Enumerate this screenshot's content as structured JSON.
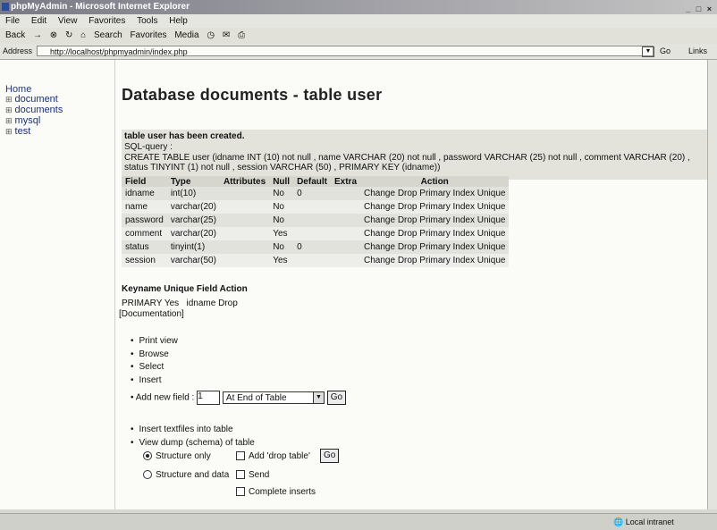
{
  "window": {
    "title": "phpMyAdmin - Microsoft Internet Explorer",
    "controls": "_ □ ×"
  },
  "menu": [
    "File",
    "Edit",
    "View",
    "Favorites",
    "Tools",
    "Help"
  ],
  "toolbar": {
    "back": "Back",
    "search": "Search",
    "favorites": "Favorites",
    "media": "Media"
  },
  "address": {
    "label": "Address",
    "url": "http://localhost/phpmyadmin/index.php",
    "go": "Go",
    "links": "Links"
  },
  "sidebar": {
    "home": "Home",
    "items": [
      "document",
      "documents",
      "mysql",
      "test"
    ],
    "expander": "⊞"
  },
  "main": {
    "title": "Database documents - table user",
    "created_msg": "table user has been created.",
    "sql_label": "SQL-query :",
    "sql_line1": "CREATE TABLE user (idname INT (10) not null , name VARCHAR (20) not null , password VARCHAR (25) not null , comment VARCHAR (20) ,",
    "sql_line2": "status TINYINT (1) not null , session VARCHAR (50) , PRIMARY KEY (idname))",
    "columns": [
      "Field",
      "Type",
      "Attributes",
      "Null",
      "Default",
      "Extra",
      "Action"
    ],
    "rows": [
      {
        "field": "idname",
        "type": "int(10)",
        "attributes": "",
        "null": "No",
        "default": "0",
        "extra": ""
      },
      {
        "field": "name",
        "type": "varchar(20)",
        "attributes": "",
        "null": "No",
        "default": "",
        "extra": ""
      },
      {
        "field": "password",
        "type": "varchar(25)",
        "attributes": "",
        "null": "No",
        "default": "",
        "extra": ""
      },
      {
        "field": "comment",
        "type": "varchar(20)",
        "attributes": "",
        "null": "Yes",
        "default": "",
        "extra": ""
      },
      {
        "field": "status",
        "type": "tinyint(1)",
        "attributes": "",
        "null": "No",
        "default": "0",
        "extra": ""
      },
      {
        "field": "session",
        "type": "varchar(50)",
        "attributes": "",
        "null": "Yes",
        "default": "",
        "extra": ""
      }
    ],
    "row_actions": [
      "Change",
      "Drop",
      "Primary",
      "Index",
      "Unique"
    ],
    "keys": {
      "headers": "Keyname Unique Field Action",
      "row": {
        "keyname": "PRIMARY",
        "unique": "Yes",
        "field": "idname",
        "action": "Drop"
      }
    },
    "documentation": "[Documentation]",
    "links": [
      "Print view",
      "Browse",
      "Select",
      "Insert"
    ],
    "add_field": {
      "label": "Add new field :",
      "value": "1",
      "position": "At End of Table",
      "go": "Go"
    },
    "dump": [
      "Insert textfiles into table",
      "View dump (schema) of table"
    ],
    "dump_options": {
      "structure_only": "Structure only",
      "structure_data": "Structure and data",
      "add_drop": "Add 'drop table'",
      "send": "Send",
      "complete": "Complete inserts",
      "go": "Go"
    }
  },
  "statusbar": {
    "zone": "Local intranet"
  }
}
